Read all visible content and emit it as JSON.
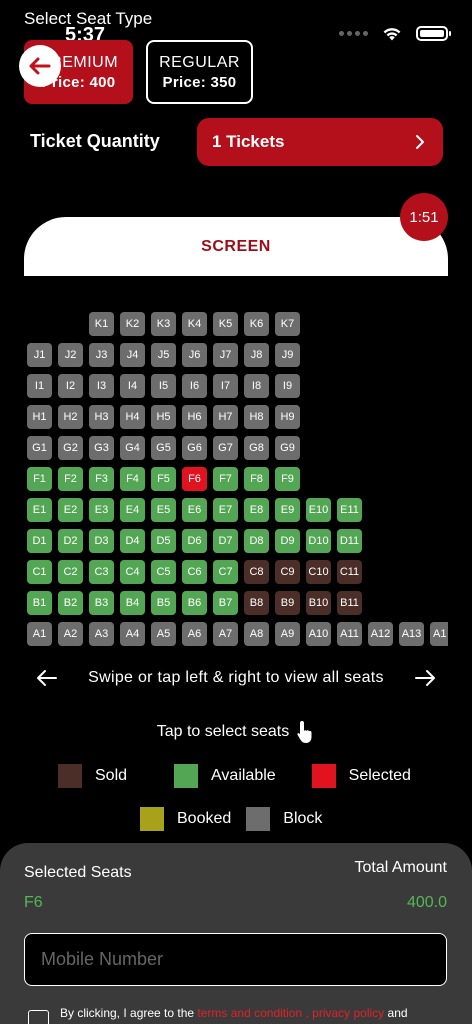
{
  "status_bar": {
    "time": "5:37"
  },
  "header": {
    "seat_type_label": "Select Seat Type"
  },
  "seat_types": [
    {
      "name": "PREMIUM",
      "price_label": "Price: 400",
      "selected": true
    },
    {
      "name": "REGULAR",
      "price_label": "Price: 350",
      "selected": false
    }
  ],
  "ticket_quantity": {
    "label": "Ticket Quantity",
    "value": "1 Tickets"
  },
  "timer": "1:51",
  "screen_label": "SCREEN",
  "seat_rows": [
    {
      "row": "K",
      "seats": [
        [
          "K1",
          "block"
        ],
        [
          "K2",
          "block"
        ],
        [
          "K3",
          "block"
        ],
        [
          "K4",
          "block"
        ],
        [
          "K5",
          "block"
        ],
        [
          "K6",
          "block"
        ],
        [
          "K7",
          "block"
        ]
      ]
    },
    {
      "row": "J",
      "seats": [
        [
          "J1",
          "block"
        ],
        [
          "J2",
          "block"
        ],
        [
          "J3",
          "block"
        ],
        [
          "J4",
          "block"
        ],
        [
          "J5",
          "block"
        ],
        [
          "J6",
          "block"
        ],
        [
          "J7",
          "block"
        ],
        [
          "J8",
          "block"
        ],
        [
          "J9",
          "block"
        ]
      ]
    },
    {
      "row": "I",
      "seats": [
        [
          "I1",
          "block"
        ],
        [
          "I2",
          "block"
        ],
        [
          "I3",
          "block"
        ],
        [
          "I4",
          "block"
        ],
        [
          "I5",
          "block"
        ],
        [
          "I6",
          "block"
        ],
        [
          "I7",
          "block"
        ],
        [
          "I8",
          "block"
        ],
        [
          "I9",
          "block"
        ]
      ]
    },
    {
      "row": "H",
      "seats": [
        [
          "H1",
          "block"
        ],
        [
          "H2",
          "block"
        ],
        [
          "H3",
          "block"
        ],
        [
          "H4",
          "block"
        ],
        [
          "H5",
          "block"
        ],
        [
          "H6",
          "block"
        ],
        [
          "H7",
          "block"
        ],
        [
          "H8",
          "block"
        ],
        [
          "H9",
          "block"
        ]
      ]
    },
    {
      "row": "G",
      "seats": [
        [
          "G1",
          "block"
        ],
        [
          "G2",
          "block"
        ],
        [
          "G3",
          "block"
        ],
        [
          "G4",
          "block"
        ],
        [
          "G5",
          "block"
        ],
        [
          "G6",
          "block"
        ],
        [
          "G7",
          "block"
        ],
        [
          "G8",
          "block"
        ],
        [
          "G9",
          "block"
        ]
      ]
    },
    {
      "row": "F",
      "seats": [
        [
          "F1",
          "available"
        ],
        [
          "F2",
          "available"
        ],
        [
          "F3",
          "available"
        ],
        [
          "F4",
          "available"
        ],
        [
          "F5",
          "available"
        ],
        [
          "F6",
          "selected"
        ],
        [
          "F7",
          "available"
        ],
        [
          "F8",
          "available"
        ],
        [
          "F9",
          "available"
        ]
      ]
    },
    {
      "row": "E",
      "seats": [
        [
          "E1",
          "available"
        ],
        [
          "E2",
          "available"
        ],
        [
          "E3",
          "available"
        ],
        [
          "E4",
          "available"
        ],
        [
          "E5",
          "available"
        ],
        [
          "E6",
          "available"
        ],
        [
          "E7",
          "available"
        ],
        [
          "E8",
          "available"
        ],
        [
          "E9",
          "available"
        ],
        [
          "E10",
          "available"
        ],
        [
          "E11",
          "available"
        ]
      ]
    },
    {
      "row": "D",
      "seats": [
        [
          "D1",
          "available"
        ],
        [
          "D2",
          "available"
        ],
        [
          "D3",
          "available"
        ],
        [
          "D4",
          "available"
        ],
        [
          "D5",
          "available"
        ],
        [
          "D6",
          "available"
        ],
        [
          "D7",
          "available"
        ],
        [
          "D8",
          "available"
        ],
        [
          "D9",
          "available"
        ],
        [
          "D10",
          "available"
        ],
        [
          "D11",
          "available"
        ]
      ]
    },
    {
      "row": "C",
      "seats": [
        [
          "C1",
          "available"
        ],
        [
          "C2",
          "available"
        ],
        [
          "C3",
          "available"
        ],
        [
          "C4",
          "available"
        ],
        [
          "C5",
          "available"
        ],
        [
          "C6",
          "available"
        ],
        [
          "C7",
          "available"
        ],
        [
          "C8",
          "sold"
        ],
        [
          "C9",
          "sold"
        ],
        [
          "C10",
          "sold"
        ],
        [
          "C11",
          "sold"
        ]
      ]
    },
    {
      "row": "B",
      "seats": [
        [
          "B1",
          "available"
        ],
        [
          "B2",
          "available"
        ],
        [
          "B3",
          "available"
        ],
        [
          "B4",
          "available"
        ],
        [
          "B5",
          "available"
        ],
        [
          "B6",
          "available"
        ],
        [
          "B7",
          "available"
        ],
        [
          "B8",
          "sold"
        ],
        [
          "B9",
          "sold"
        ],
        [
          "B10",
          "sold"
        ],
        [
          "B11",
          "sold"
        ]
      ]
    },
    {
      "row": "A",
      "seats": [
        [
          "A1",
          "block"
        ],
        [
          "A2",
          "block"
        ],
        [
          "A3",
          "block"
        ],
        [
          "A4",
          "block"
        ],
        [
          "A5",
          "block"
        ],
        [
          "A6",
          "block"
        ],
        [
          "A7",
          "block"
        ],
        [
          "A8",
          "block"
        ],
        [
          "A9",
          "block"
        ],
        [
          "A10",
          "block"
        ],
        [
          "A11",
          "block"
        ],
        [
          "A12",
          "block"
        ],
        [
          "A13",
          "block"
        ],
        [
          "A1",
          "block"
        ]
      ]
    }
  ],
  "swipe_hint": "Swipe or tap left & right to view all seats",
  "tap_hint": "Tap to select seats",
  "legend": {
    "sold": {
      "label": "Sold",
      "color": "#4a2e27"
    },
    "available": {
      "label": "Available",
      "color": "#53a653"
    },
    "selected": {
      "label": "Selected",
      "color": "#e0131e"
    },
    "booked": {
      "label": "Booked",
      "color": "#a8a21a"
    },
    "block": {
      "label": "Block",
      "color": "#6d6d6d"
    }
  },
  "summary": {
    "selected_seats_label": "Selected Seats",
    "selected_seats_value": "F6",
    "total_amount_label": "Total Amount",
    "total_amount_value": "400.0"
  },
  "mobile": {
    "placeholder": "Mobile Number",
    "value": ""
  },
  "agreement": {
    "prefix": "By clicking, I agree to the ",
    "terms_link": "terms and condition",
    "separator": " , ",
    "privacy_link": "privacy policy",
    "suffix": " and"
  },
  "colors": {
    "accent": "#b3101c",
    "success_text": "#53b853",
    "sheet_bg": "#3a3a3a"
  },
  "icons": {
    "back": "arrow-left-icon",
    "chevron": "chevron-right-icon",
    "hand": "pointing-hand-icon"
  }
}
